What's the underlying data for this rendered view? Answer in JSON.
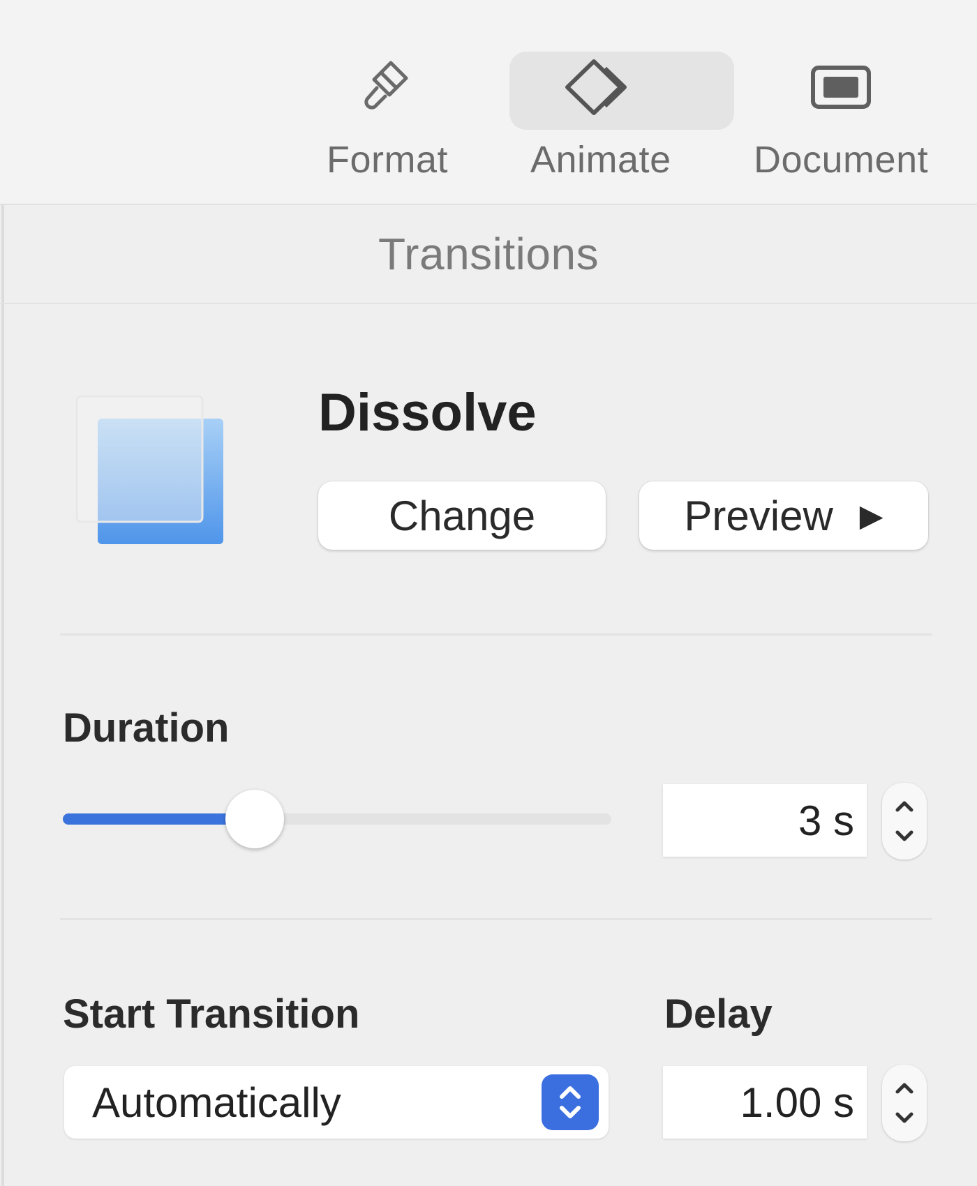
{
  "toolbar": {
    "tabs": [
      {
        "label": "Format",
        "icon": "paintbrush-icon"
      },
      {
        "label": "Animate",
        "icon": "diamonds-icon",
        "active": true
      },
      {
        "label": "Document",
        "icon": "document-icon"
      }
    ]
  },
  "section": {
    "title": "Transitions"
  },
  "transition": {
    "name": "Dissolve",
    "change_label": "Change",
    "preview_label": "Preview",
    "preview_icon": "play-icon"
  },
  "duration": {
    "label": "Duration",
    "value": "3 s",
    "slider_fraction": 0.35
  },
  "start": {
    "label": "Start Transition",
    "selected": "Automatically"
  },
  "delay": {
    "label": "Delay",
    "value": "1.00 s"
  },
  "colors": {
    "accent": "#3b73dc",
    "select_button": "#3b6fe0"
  }
}
